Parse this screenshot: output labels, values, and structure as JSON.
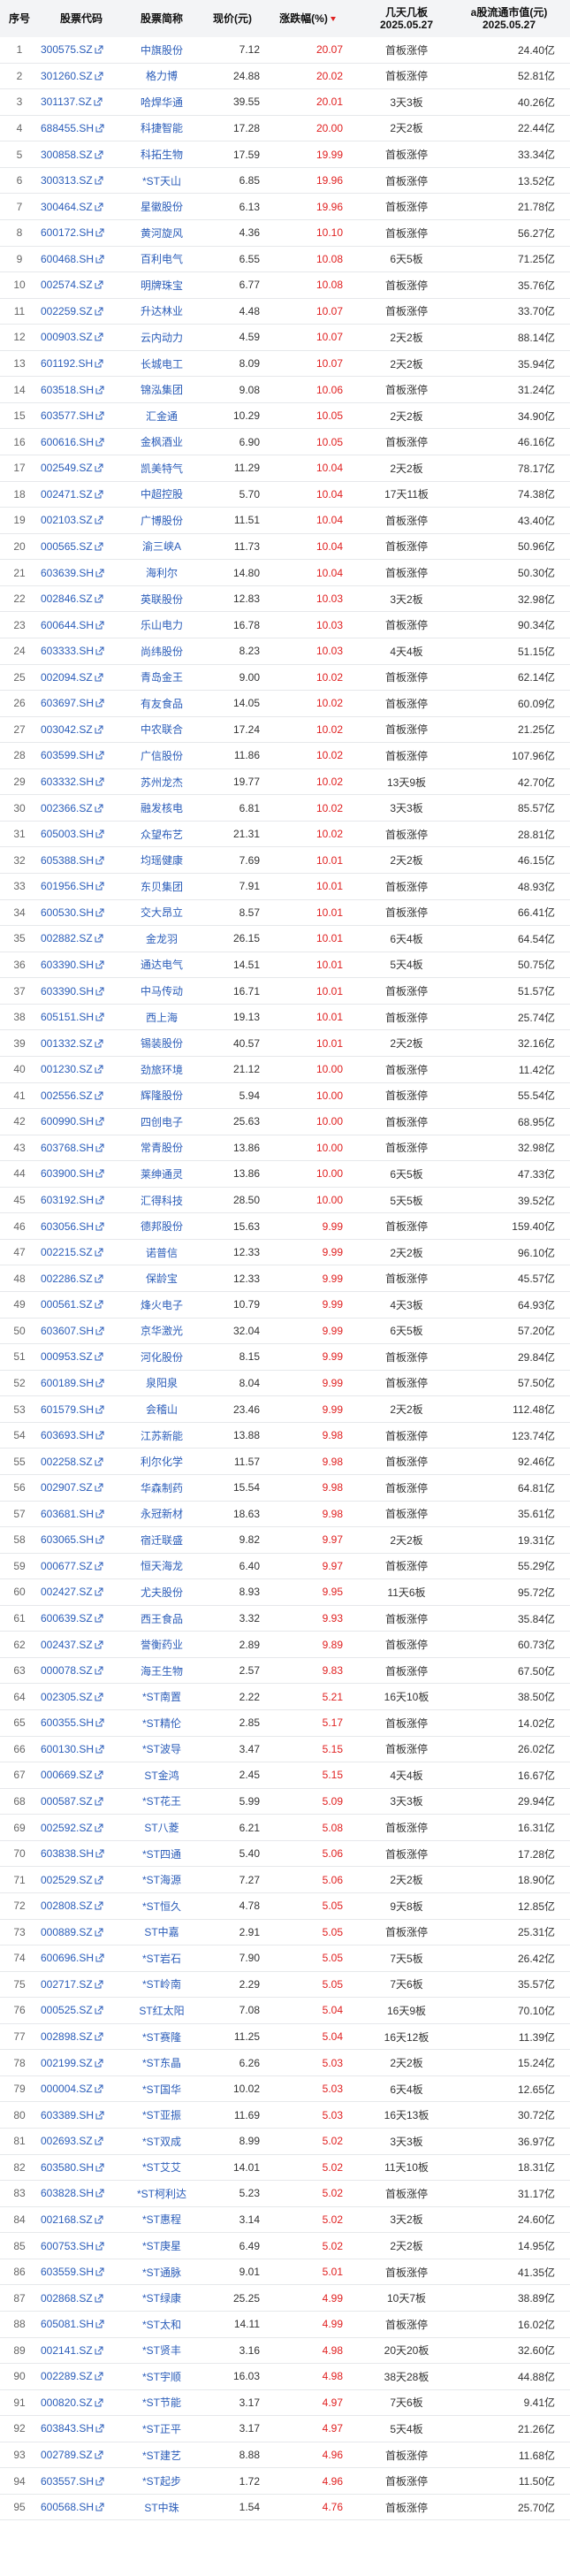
{
  "header": {
    "col_no": "序号",
    "col_code": "股票代码",
    "col_name": "股票简称",
    "col_price": "现价(元)",
    "col_chg": "涨跌幅(%)",
    "col_board_l1": "几天几板",
    "col_board_l2": "2025.05.27",
    "col_cap_l1": "a股流通市值(元)",
    "col_cap_l2": "2025.05.27"
  },
  "colors": {
    "up": "#e02020",
    "link": "#2b5db9",
    "header_bg": "#f3f4f6"
  },
  "icons": {
    "code_link": "external-link-icon",
    "sort": "sort-desc-icon"
  },
  "rows": [
    {
      "no": "1",
      "code": "300575.SZ",
      "name": "中旗股份",
      "price": "7.12",
      "chg": "20.07",
      "board": "首板涨停",
      "cap": "24.40亿"
    },
    {
      "no": "2",
      "code": "301260.SZ",
      "name": "格力博",
      "price": "24.88",
      "chg": "20.02",
      "board": "首板涨停",
      "cap": "52.81亿"
    },
    {
      "no": "3",
      "code": "301137.SZ",
      "name": "哈焊华通",
      "price": "39.55",
      "chg": "20.01",
      "board": "3天3板",
      "cap": "40.26亿"
    },
    {
      "no": "4",
      "code": "688455.SH",
      "name": "科捷智能",
      "price": "17.28",
      "chg": "20.00",
      "board": "2天2板",
      "cap": "22.44亿"
    },
    {
      "no": "5",
      "code": "300858.SZ",
      "name": "科拓生物",
      "price": "17.59",
      "chg": "19.99",
      "board": "首板涨停",
      "cap": "33.34亿"
    },
    {
      "no": "6",
      "code": "300313.SZ",
      "name": "*ST天山",
      "price": "6.85",
      "chg": "19.96",
      "board": "首板涨停",
      "cap": "13.52亿"
    },
    {
      "no": "7",
      "code": "300464.SZ",
      "name": "星徽股份",
      "price": "6.13",
      "chg": "19.96",
      "board": "首板涨停",
      "cap": "21.78亿"
    },
    {
      "no": "8",
      "code": "600172.SH",
      "name": "黄河旋风",
      "price": "4.36",
      "chg": "10.10",
      "board": "首板涨停",
      "cap": "56.27亿"
    },
    {
      "no": "9",
      "code": "600468.SH",
      "name": "百利电气",
      "price": "6.55",
      "chg": "10.08",
      "board": "6天5板",
      "cap": "71.25亿"
    },
    {
      "no": "10",
      "code": "002574.SZ",
      "name": "明牌珠宝",
      "price": "6.77",
      "chg": "10.08",
      "board": "首板涨停",
      "cap": "35.76亿"
    },
    {
      "no": "11",
      "code": "002259.SZ",
      "name": "升达林业",
      "price": "4.48",
      "chg": "10.07",
      "board": "首板涨停",
      "cap": "33.70亿"
    },
    {
      "no": "12",
      "code": "000903.SZ",
      "name": "云内动力",
      "price": "4.59",
      "chg": "10.07",
      "board": "2天2板",
      "cap": "88.14亿"
    },
    {
      "no": "13",
      "code": "601192.SH",
      "name": "长城电工",
      "price": "8.09",
      "chg": "10.07",
      "board": "2天2板",
      "cap": "35.94亿"
    },
    {
      "no": "14",
      "code": "603518.SH",
      "name": "锦泓集团",
      "price": "9.08",
      "chg": "10.06",
      "board": "首板涨停",
      "cap": "31.24亿"
    },
    {
      "no": "15",
      "code": "603577.SH",
      "name": "汇金通",
      "price": "10.29",
      "chg": "10.05",
      "board": "2天2板",
      "cap": "34.90亿"
    },
    {
      "no": "16",
      "code": "600616.SH",
      "name": "金枫酒业",
      "price": "6.90",
      "chg": "10.05",
      "board": "首板涨停",
      "cap": "46.16亿"
    },
    {
      "no": "17",
      "code": "002549.SZ",
      "name": "凯美特气",
      "price": "11.29",
      "chg": "10.04",
      "board": "2天2板",
      "cap": "78.17亿"
    },
    {
      "no": "18",
      "code": "002471.SZ",
      "name": "中超控股",
      "price": "5.70",
      "chg": "10.04",
      "board": "17天11板",
      "cap": "74.38亿"
    },
    {
      "no": "19",
      "code": "002103.SZ",
      "name": "广博股份",
      "price": "11.51",
      "chg": "10.04",
      "board": "首板涨停",
      "cap": "43.40亿"
    },
    {
      "no": "20",
      "code": "000565.SZ",
      "name": "渝三峡A",
      "price": "11.73",
      "chg": "10.04",
      "board": "首板涨停",
      "cap": "50.96亿"
    },
    {
      "no": "21",
      "code": "603639.SH",
      "name": "海利尔",
      "price": "14.80",
      "chg": "10.04",
      "board": "首板涨停",
      "cap": "50.30亿"
    },
    {
      "no": "22",
      "code": "002846.SZ",
      "name": "英联股份",
      "price": "12.83",
      "chg": "10.03",
      "board": "3天2板",
      "cap": "32.98亿"
    },
    {
      "no": "23",
      "code": "600644.SH",
      "name": "乐山电力",
      "price": "16.78",
      "chg": "10.03",
      "board": "首板涨停",
      "cap": "90.34亿"
    },
    {
      "no": "24",
      "code": "603333.SH",
      "name": "尚纬股份",
      "price": "8.23",
      "chg": "10.03",
      "board": "4天4板",
      "cap": "51.15亿"
    },
    {
      "no": "25",
      "code": "002094.SZ",
      "name": "青岛金王",
      "price": "9.00",
      "chg": "10.02",
      "board": "首板涨停",
      "cap": "62.14亿"
    },
    {
      "no": "26",
      "code": "603697.SH",
      "name": "有友食品",
      "price": "14.05",
      "chg": "10.02",
      "board": "首板涨停",
      "cap": "60.09亿"
    },
    {
      "no": "27",
      "code": "003042.SZ",
      "name": "中农联合",
      "price": "17.24",
      "chg": "10.02",
      "board": "首板涨停",
      "cap": "21.25亿"
    },
    {
      "no": "28",
      "code": "603599.SH",
      "name": "广信股份",
      "price": "11.86",
      "chg": "10.02",
      "board": "首板涨停",
      "cap": "107.96亿"
    },
    {
      "no": "29",
      "code": "603332.SH",
      "name": "苏州龙杰",
      "price": "19.77",
      "chg": "10.02",
      "board": "13天9板",
      "cap": "42.70亿"
    },
    {
      "no": "30",
      "code": "002366.SZ",
      "name": "融发核电",
      "price": "6.81",
      "chg": "10.02",
      "board": "3天3板",
      "cap": "85.57亿"
    },
    {
      "no": "31",
      "code": "605003.SH",
      "name": "众望布艺",
      "price": "21.31",
      "chg": "10.02",
      "board": "首板涨停",
      "cap": "28.81亿"
    },
    {
      "no": "32",
      "code": "605388.SH",
      "name": "均瑶健康",
      "price": "7.69",
      "chg": "10.01",
      "board": "2天2板",
      "cap": "46.15亿"
    },
    {
      "no": "33",
      "code": "601956.SH",
      "name": "东贝集团",
      "price": "7.91",
      "chg": "10.01",
      "board": "首板涨停",
      "cap": "48.93亿"
    },
    {
      "no": "34",
      "code": "600530.SH",
      "name": "交大昂立",
      "price": "8.57",
      "chg": "10.01",
      "board": "首板涨停",
      "cap": "66.41亿"
    },
    {
      "no": "35",
      "code": "002882.SZ",
      "name": "金龙羽",
      "price": "26.15",
      "chg": "10.01",
      "board": "6天4板",
      "cap": "64.54亿"
    },
    {
      "no": "36",
      "code": "603390.SH",
      "name": "通达电气",
      "price": "14.51",
      "chg": "10.01",
      "board": "5天4板",
      "cap": "50.75亿"
    },
    {
      "no": "37",
      "code": "603390.SH",
      "name": "中马传动",
      "price": "16.71",
      "chg": "10.01",
      "board": "首板涨停",
      "cap": "51.57亿"
    },
    {
      "no": "38",
      "code": "605151.SH",
      "name": "西上海",
      "price": "19.13",
      "chg": "10.01",
      "board": "首板涨停",
      "cap": "25.74亿"
    },
    {
      "no": "39",
      "code": "001332.SZ",
      "name": "锡装股份",
      "price": "40.57",
      "chg": "10.01",
      "board": "2天2板",
      "cap": "32.16亿"
    },
    {
      "no": "40",
      "code": "001230.SZ",
      "name": "劲旅环境",
      "price": "21.12",
      "chg": "10.00",
      "board": "首板涨停",
      "cap": "11.42亿"
    },
    {
      "no": "41",
      "code": "002556.SZ",
      "name": "辉隆股份",
      "price": "5.94",
      "chg": "10.00",
      "board": "首板涨停",
      "cap": "55.54亿"
    },
    {
      "no": "42",
      "code": "600990.SH",
      "name": "四创电子",
      "price": "25.63",
      "chg": "10.00",
      "board": "首板涨停",
      "cap": "68.95亿"
    },
    {
      "no": "43",
      "code": "603768.SH",
      "name": "常青股份",
      "price": "13.86",
      "chg": "10.00",
      "board": "首板涨停",
      "cap": "32.98亿"
    },
    {
      "no": "44",
      "code": "603900.SH",
      "name": "莱绅通灵",
      "price": "13.86",
      "chg": "10.00",
      "board": "6天5板",
      "cap": "47.33亿"
    },
    {
      "no": "45",
      "code": "603192.SH",
      "name": "汇得科技",
      "price": "28.50",
      "chg": "10.00",
      "board": "5天5板",
      "cap": "39.52亿"
    },
    {
      "no": "46",
      "code": "603056.SH",
      "name": "德邦股份",
      "price": "15.63",
      "chg": "9.99",
      "board": "首板涨停",
      "cap": "159.40亿"
    },
    {
      "no": "47",
      "code": "002215.SZ",
      "name": "诺普信",
      "price": "12.33",
      "chg": "9.99",
      "board": "2天2板",
      "cap": "96.10亿"
    },
    {
      "no": "48",
      "code": "002286.SZ",
      "name": "保龄宝",
      "price": "12.33",
      "chg": "9.99",
      "board": "首板涨停",
      "cap": "45.57亿"
    },
    {
      "no": "49",
      "code": "000561.SZ",
      "name": "烽火电子",
      "price": "10.79",
      "chg": "9.99",
      "board": "4天3板",
      "cap": "64.93亿"
    },
    {
      "no": "50",
      "code": "603607.SH",
      "name": "京华激光",
      "price": "32.04",
      "chg": "9.99",
      "board": "6天5板",
      "cap": "57.20亿"
    },
    {
      "no": "51",
      "code": "000953.SZ",
      "name": "河化股份",
      "price": "8.15",
      "chg": "9.99",
      "board": "首板涨停",
      "cap": "29.84亿"
    },
    {
      "no": "52",
      "code": "600189.SH",
      "name": "泉阳泉",
      "price": "8.04",
      "chg": "9.99",
      "board": "首板涨停",
      "cap": "57.50亿"
    },
    {
      "no": "53",
      "code": "601579.SH",
      "name": "会稽山",
      "price": "23.46",
      "chg": "9.99",
      "board": "2天2板",
      "cap": "112.48亿"
    },
    {
      "no": "54",
      "code": "603693.SH",
      "name": "江苏新能",
      "price": "13.88",
      "chg": "9.98",
      "board": "首板涨停",
      "cap": "123.74亿"
    },
    {
      "no": "55",
      "code": "002258.SZ",
      "name": "利尔化学",
      "price": "11.57",
      "chg": "9.98",
      "board": "首板涨停",
      "cap": "92.46亿"
    },
    {
      "no": "56",
      "code": "002907.SZ",
      "name": "华森制药",
      "price": "15.54",
      "chg": "9.98",
      "board": "首板涨停",
      "cap": "64.81亿"
    },
    {
      "no": "57",
      "code": "603681.SH",
      "name": "永冠新材",
      "price": "18.63",
      "chg": "9.98",
      "board": "首板涨停",
      "cap": "35.61亿"
    },
    {
      "no": "58",
      "code": "603065.SH",
      "name": "宿迁联盛",
      "price": "9.82",
      "chg": "9.97",
      "board": "2天2板",
      "cap": "19.31亿"
    },
    {
      "no": "59",
      "code": "000677.SZ",
      "name": "恒天海龙",
      "price": "6.40",
      "chg": "9.97",
      "board": "首板涨停",
      "cap": "55.29亿"
    },
    {
      "no": "60",
      "code": "002427.SZ",
      "name": "尤夫股份",
      "price": "8.93",
      "chg": "9.95",
      "board": "11天6板",
      "cap": "95.72亿"
    },
    {
      "no": "61",
      "code": "600639.SZ",
      "name": "西王食品",
      "price": "3.32",
      "chg": "9.93",
      "board": "首板涨停",
      "cap": "35.84亿"
    },
    {
      "no": "62",
      "code": "002437.SZ",
      "name": "誉衡药业",
      "price": "2.89",
      "chg": "9.89",
      "board": "首板涨停",
      "cap": "60.73亿"
    },
    {
      "no": "63",
      "code": "000078.SZ",
      "name": "海王生物",
      "price": "2.57",
      "chg": "9.83",
      "board": "首板涨停",
      "cap": "67.50亿"
    },
    {
      "no": "64",
      "code": "002305.SZ",
      "name": "*ST南置",
      "price": "2.22",
      "chg": "5.21",
      "board": "16天10板",
      "cap": "38.50亿"
    },
    {
      "no": "65",
      "code": "600355.SH",
      "name": "*ST精伦",
      "price": "2.85",
      "chg": "5.17",
      "board": "首板涨停",
      "cap": "14.02亿"
    },
    {
      "no": "66",
      "code": "600130.SH",
      "name": "*ST波导",
      "price": "3.47",
      "chg": "5.15",
      "board": "首板涨停",
      "cap": "26.02亿"
    },
    {
      "no": "67",
      "code": "000669.SZ",
      "name": "ST金鸿",
      "price": "2.45",
      "chg": "5.15",
      "board": "4天4板",
      "cap": "16.67亿"
    },
    {
      "no": "68",
      "code": "000587.SZ",
      "name": "*ST花王",
      "price": "5.99",
      "chg": "5.09",
      "board": "3天3板",
      "cap": "29.94亿"
    },
    {
      "no": "69",
      "code": "002592.SZ",
      "name": "ST八菱",
      "price": "6.21",
      "chg": "5.08",
      "board": "首板涨停",
      "cap": "16.31亿"
    },
    {
      "no": "70",
      "code": "603838.SH",
      "name": "*ST四通",
      "price": "5.40",
      "chg": "5.06",
      "board": "首板涨停",
      "cap": "17.28亿"
    },
    {
      "no": "71",
      "code": "002529.SZ",
      "name": "*ST海源",
      "price": "7.27",
      "chg": "5.06",
      "board": "2天2板",
      "cap": "18.90亿"
    },
    {
      "no": "72",
      "code": "002808.SZ",
      "name": "*ST恒久",
      "price": "4.78",
      "chg": "5.05",
      "board": "9天8板",
      "cap": "12.85亿"
    },
    {
      "no": "73",
      "code": "000889.SZ",
      "name": "ST中嘉",
      "price": "2.91",
      "chg": "5.05",
      "board": "首板涨停",
      "cap": "25.31亿"
    },
    {
      "no": "74",
      "code": "600696.SH",
      "name": "*ST岩石",
      "price": "7.90",
      "chg": "5.05",
      "board": "7天5板",
      "cap": "26.42亿"
    },
    {
      "no": "75",
      "code": "002717.SZ",
      "name": "*ST岭南",
      "price": "2.29",
      "chg": "5.05",
      "board": "7天6板",
      "cap": "35.57亿"
    },
    {
      "no": "76",
      "code": "000525.SZ",
      "name": "ST红太阳",
      "price": "7.08",
      "chg": "5.04",
      "board": "16天9板",
      "cap": "70.10亿"
    },
    {
      "no": "77",
      "code": "002898.SZ",
      "name": "*ST赛隆",
      "price": "11.25",
      "chg": "5.04",
      "board": "16天12板",
      "cap": "11.39亿"
    },
    {
      "no": "78",
      "code": "002199.SZ",
      "name": "*ST东晶",
      "price": "6.26",
      "chg": "5.03",
      "board": "2天2板",
      "cap": "15.24亿"
    },
    {
      "no": "79",
      "code": "000004.SZ",
      "name": "*ST国华",
      "price": "10.02",
      "chg": "5.03",
      "board": "6天4板",
      "cap": "12.65亿"
    },
    {
      "no": "80",
      "code": "603389.SH",
      "name": "*ST亚振",
      "price": "11.69",
      "chg": "5.03",
      "board": "16天13板",
      "cap": "30.72亿"
    },
    {
      "no": "81",
      "code": "002693.SZ",
      "name": "*ST双成",
      "price": "8.99",
      "chg": "5.02",
      "board": "3天3板",
      "cap": "36.97亿"
    },
    {
      "no": "82",
      "code": "603580.SH",
      "name": "*ST艾艾",
      "price": "14.01",
      "chg": "5.02",
      "board": "11天10板",
      "cap": "18.31亿"
    },
    {
      "no": "83",
      "code": "603828.SH",
      "name": "*ST柯利达",
      "price": "5.23",
      "chg": "5.02",
      "board": "首板涨停",
      "cap": "31.17亿"
    },
    {
      "no": "84",
      "code": "002168.SZ",
      "name": "*ST惠程",
      "price": "3.14",
      "chg": "5.02",
      "board": "3天2板",
      "cap": "24.60亿"
    },
    {
      "no": "85",
      "code": "600753.SH",
      "name": "*ST庚星",
      "price": "6.49",
      "chg": "5.02",
      "board": "2天2板",
      "cap": "14.95亿"
    },
    {
      "no": "86",
      "code": "603559.SH",
      "name": "*ST通脉",
      "price": "9.01",
      "chg": "5.01",
      "board": "首板涨停",
      "cap": "41.35亿"
    },
    {
      "no": "87",
      "code": "002868.SZ",
      "name": "*ST绿康",
      "price": "25.25",
      "chg": "4.99",
      "board": "10天7板",
      "cap": "38.89亿"
    },
    {
      "no": "88",
      "code": "605081.SH",
      "name": "*ST太和",
      "price": "14.11",
      "chg": "4.99",
      "board": "首板涨停",
      "cap": "16.02亿"
    },
    {
      "no": "89",
      "code": "002141.SZ",
      "name": "*ST贤丰",
      "price": "3.16",
      "chg": "4.98",
      "board": "20天20板",
      "cap": "32.60亿"
    },
    {
      "no": "90",
      "code": "002289.SZ",
      "name": "*ST宇顺",
      "price": "16.03",
      "chg": "4.98",
      "board": "38天28板",
      "cap": "44.88亿"
    },
    {
      "no": "91",
      "code": "000820.SZ",
      "name": "*ST节能",
      "price": "3.17",
      "chg": "4.97",
      "board": "7天6板",
      "cap": "9.41亿"
    },
    {
      "no": "92",
      "code": "603843.SH",
      "name": "*ST正平",
      "price": "3.17",
      "chg": "4.97",
      "board": "5天4板",
      "cap": "21.26亿"
    },
    {
      "no": "93",
      "code": "002789.SZ",
      "name": "*ST建艺",
      "price": "8.88",
      "chg": "4.96",
      "board": "首板涨停",
      "cap": "11.68亿"
    },
    {
      "no": "94",
      "code": "603557.SH",
      "name": "*ST起步",
      "price": "1.72",
      "chg": "4.96",
      "board": "首板涨停",
      "cap": "11.50亿"
    },
    {
      "no": "95",
      "code": "600568.SH",
      "name": "ST中珠",
      "price": "1.54",
      "chg": "4.76",
      "board": "首板涨停",
      "cap": "25.70亿"
    }
  ]
}
